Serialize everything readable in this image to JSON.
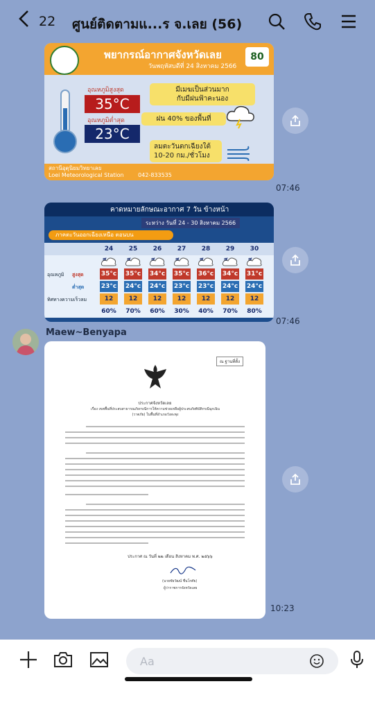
{
  "header": {
    "back_icon": "chevron-left-icon",
    "count": "22",
    "title": "ศูนย์ติดตามแ...ร จ.เลย (56)",
    "icons": [
      "search-icon",
      "phone-icon",
      "menu-icon"
    ]
  },
  "messages": {
    "weather1": {
      "title": "พยากรณ์อากาศจังหวัดเลย",
      "date": "วันพฤหัสบดีที่ 24 สิงหาคม 2566",
      "badge": "80",
      "max_label": "อุณหภูมิสูงสุด",
      "max_temp": "35°C",
      "min_label": "อุณหภูมิต่ำสุด",
      "min_temp": "23°C",
      "cloud": "มีเมฆเป็นส่วนมาก\nกับมีฝนฟ้าคะนอง",
      "rain": "ฝน 40% ของพื้นที่",
      "wind": "ลมตะวันตกเฉียงใต้\n10-20 กม./ชั่วโมง",
      "station_th": "สถานีอุตุนิยมวิทยาเลย",
      "station_en": "Loei Meteorological Station",
      "phone": "042-833535",
      "time": "07:46"
    },
    "weather2": {
      "title": "คาดหมายลักษณะอากาศ 7 วัน ข้างหน้า",
      "subtitle": "ระหว่าง วันที่ 24 - 30 สิงหาคม 2566",
      "banner": "ภาคตะวันออกเฉียงเหนือ ตอนบน",
      "days": [
        "24 ส.ค.",
        "25 ส.ค.",
        "26 ส.ค.",
        "27 ส.ค.",
        "28 ส.ค.",
        "29 ส.ค.",
        "30 ส.ค."
      ],
      "max_label": "สูงสุด",
      "min_label": "ต่ำสุด",
      "temp_label": "อุณหภูมิ",
      "wind_label": "ทิศทางความเร็วลม",
      "max_temps": [
        "35°c",
        "35°c",
        "34°c",
        "35°c",
        "36°c",
        "34°c",
        "31°c"
      ],
      "min_temps": [
        "23°c",
        "24°c",
        "24°c",
        "23°c",
        "23°c",
        "24°c",
        "24°c"
      ],
      "wind": [
        "12",
        "12",
        "12",
        "12",
        "12",
        "12",
        "12"
      ],
      "rain": [
        "60%",
        "70%",
        "60%",
        "30%",
        "40%",
        "70%",
        "80%"
      ],
      "time": "07:46"
    },
    "sender": "Maew~Benyapa",
    "document": {
      "stamp": "ณ ฐานที่ตั้ง",
      "heading": "ประกาศจังหวัดเลย",
      "subject": "เรื่อง เขตพื้นที่ประสบสาธารณภัยกรณีการให้ความช่วยเหลือผู้ประสบภัยพิบัติกรณีฉุกเฉิน",
      "subject2": "(วาตภัย) ในพื้นที่อำเภอวังสะพุง",
      "date_line": "ประกาศ ณ วันที่ ๒๒ เดือน สิงหาคม พ.ศ. ๒๕๖๖",
      "signer_name": "(นายชัยวัฒน์ ชื่นโกศัย)",
      "signer_title": "ผู้ว่าราชการจังหวัดเลย",
      "time": "10:23"
    }
  },
  "input": {
    "placeholder": "Aa",
    "icons": [
      "plus-icon",
      "camera-icon",
      "image-icon",
      "emoji-icon",
      "microphone-icon"
    ]
  }
}
